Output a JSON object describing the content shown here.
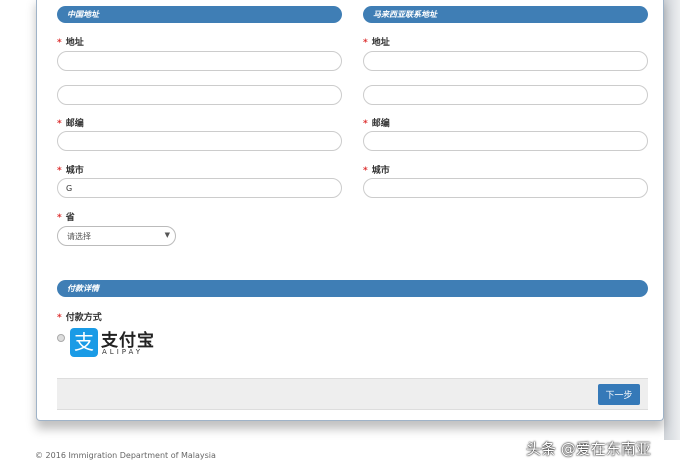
{
  "sections": {
    "china_address": "中国地址",
    "malaysia_address": "马来西亚联系地址",
    "payment": "付款详情"
  },
  "labels": {
    "address": "地址",
    "postcode": "邮编",
    "city": "城市",
    "state": "省",
    "payment_method": "付款方式",
    "required": "*"
  },
  "fields": {
    "cn_city_value": "G",
    "state_placeholder": "请选择"
  },
  "payment": {
    "brand_cn": "支付宝",
    "brand_en": "ALIPAY",
    "logo_glyph": "支"
  },
  "buttons": {
    "next": "下一步"
  },
  "footer": "© 2016 Immigration Department of Malaysia",
  "watermark": "头条 @爱在东南亚"
}
